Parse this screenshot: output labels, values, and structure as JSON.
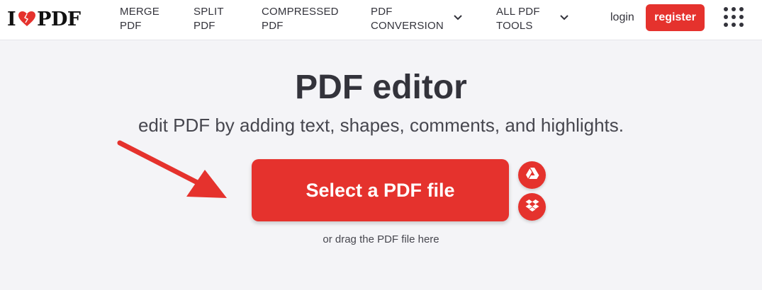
{
  "brand": {
    "logo_left": "I",
    "logo_right": "PDF",
    "accent": "#e5322d"
  },
  "nav": {
    "items": [
      {
        "line1": "MERGE",
        "line2": "PDF"
      },
      {
        "line1": "SPLIT",
        "line2": "PDF"
      },
      {
        "line1": "COMPRESSED",
        "line2": "PDF"
      },
      {
        "line1": "PDF",
        "line2": "CONVERSION"
      },
      {
        "line1": "ALL PDF",
        "line2": "TOOLS"
      }
    ],
    "login": "login",
    "register": "register"
  },
  "main": {
    "title": "PDF editor",
    "subtitle": "edit PDF by adding text, shapes, comments, and highlights.",
    "select_label": "Select a PDF file",
    "drag_hint": "or drag the PDF file here",
    "icons": [
      "heart-icon",
      "chevron-down-icon",
      "apps-grid-icon",
      "google-drive-icon",
      "dropbox-icon",
      "arrow-annotation-icon"
    ]
  }
}
